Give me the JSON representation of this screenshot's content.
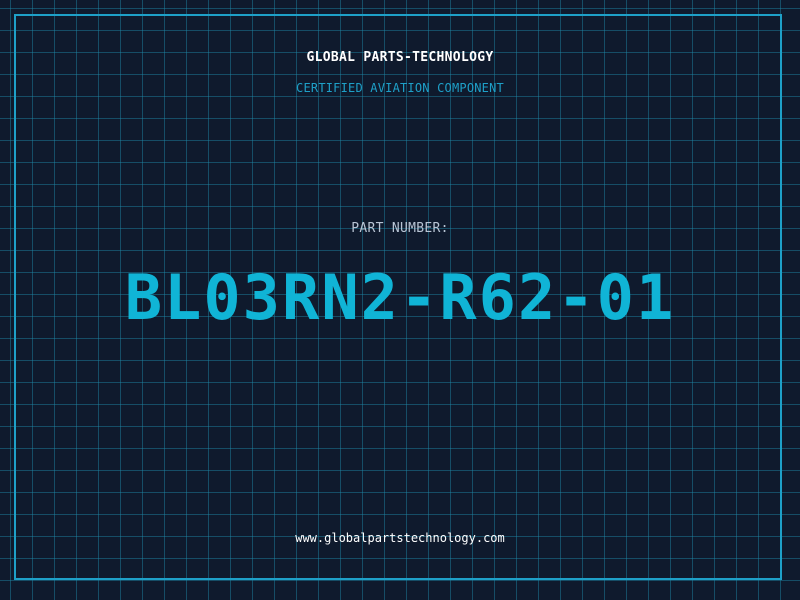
{
  "header": {
    "company_name": "GLOBAL PARTS-TECHNOLOGY",
    "subtitle": "CERTIFIED AVIATION COMPONENT"
  },
  "part": {
    "label": "PART NUMBER:",
    "number": "BL03RN2-R62-01"
  },
  "footer": {
    "website": "www.globalpartstechnology.com"
  },
  "colors": {
    "background": "#0f1a2d",
    "grid": "#1e8caa",
    "accent": "#10b4d6",
    "frame": "#1ea0c8",
    "text_primary": "#ffffff",
    "text_muted": "#b8c4d4"
  }
}
